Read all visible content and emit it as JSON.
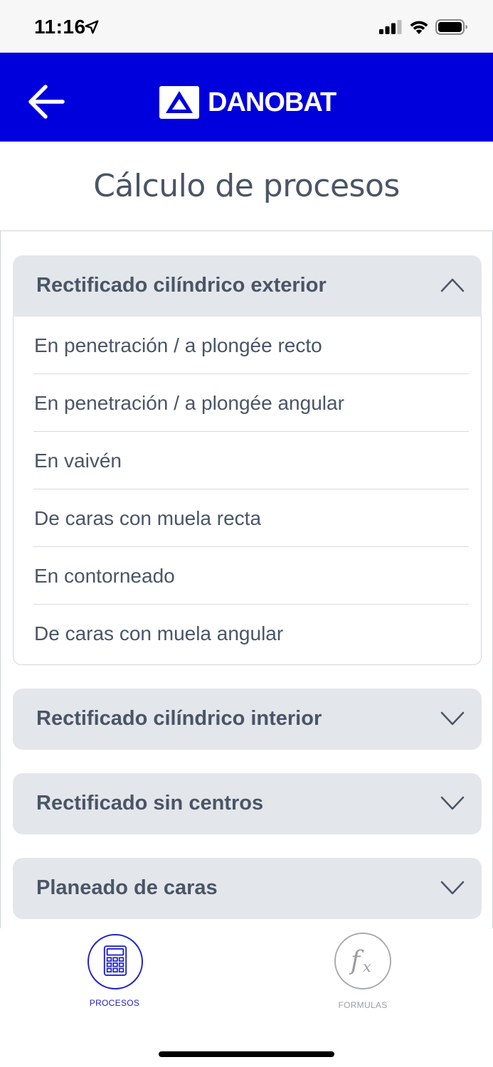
{
  "status_bar": {
    "time": "11:16"
  },
  "header": {
    "brand": "DANOBAT"
  },
  "page": {
    "title": "Cálculo de procesos"
  },
  "sections": [
    {
      "title": "Rectificado cilíndrico exterior",
      "expanded": true,
      "items": [
        "En penetración / a plongée recto",
        "En penetración / a plongée angular",
        "En vaivén",
        "De caras con muela recta",
        "En contorneado",
        "De caras con muela angular"
      ]
    },
    {
      "title": "Rectificado cilíndrico interior",
      "expanded": false
    },
    {
      "title": "Rectificado sin centros",
      "expanded": false
    },
    {
      "title": "Planeado de caras",
      "expanded": false
    }
  ],
  "tabs": [
    {
      "label": "PROCESOS",
      "active": true,
      "icon": "calculator-icon"
    },
    {
      "label": "FORMULAS",
      "active": false,
      "icon": "function-fx-icon"
    }
  ],
  "colors": {
    "header_bg": "#0000dc",
    "accordion_bg": "#e3e6eb",
    "active_tab": "#1e22c8"
  }
}
